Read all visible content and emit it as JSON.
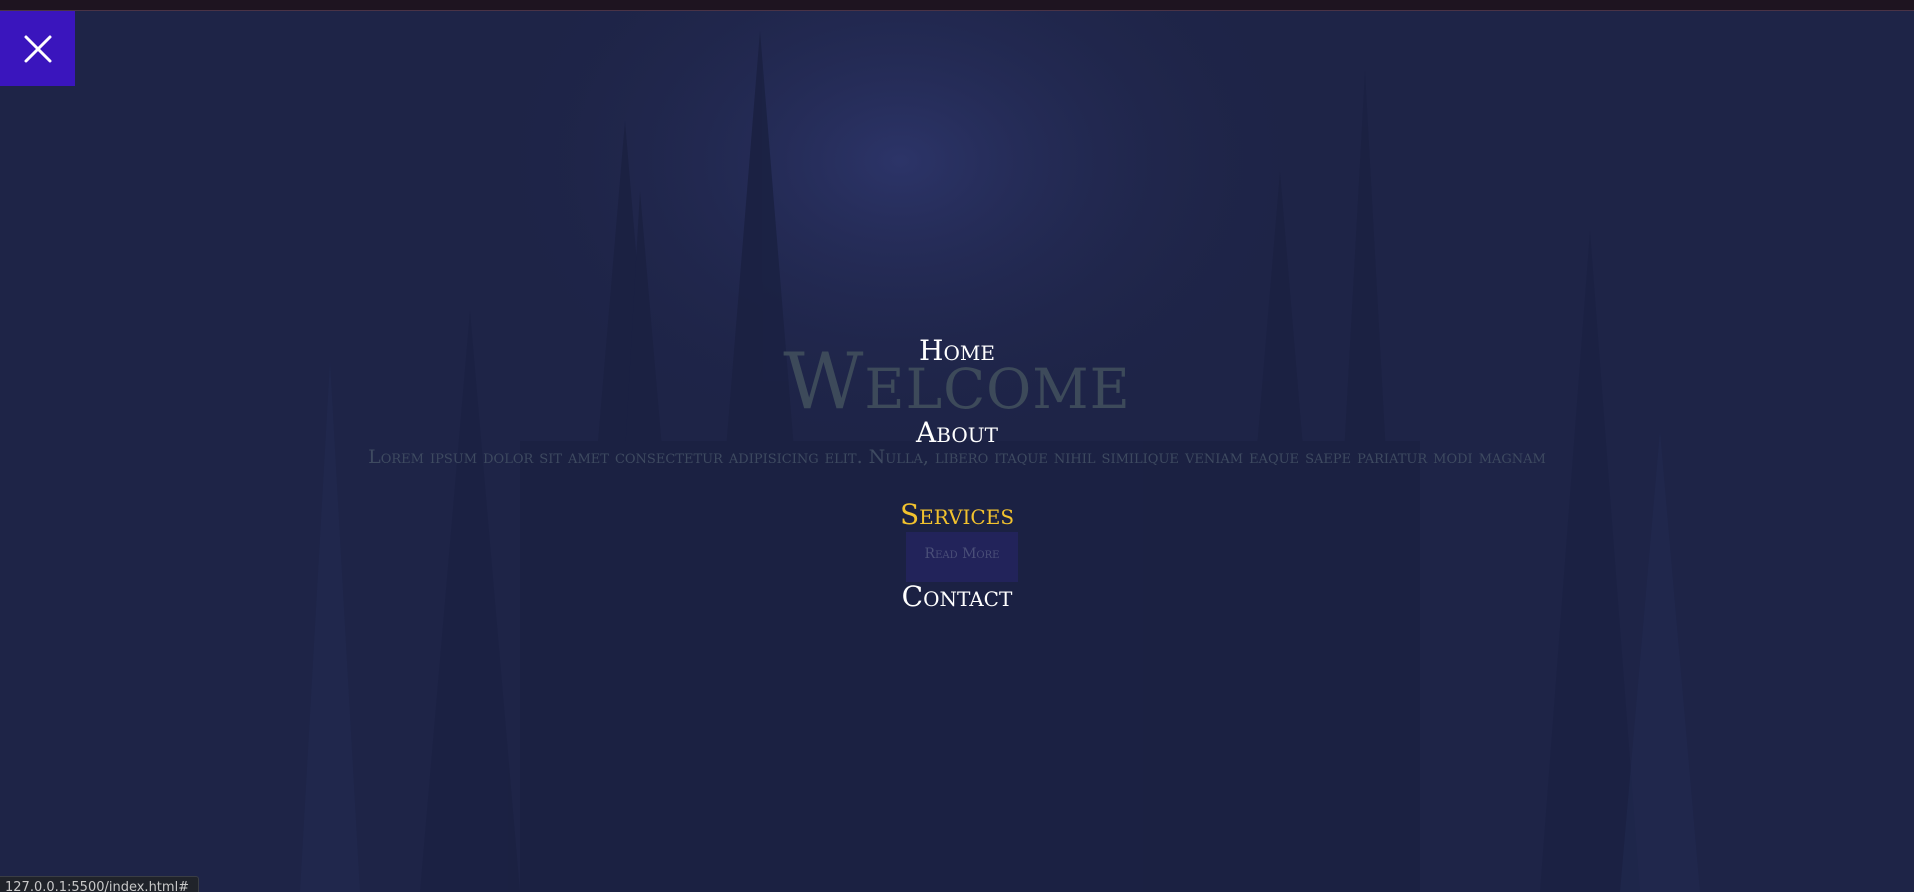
{
  "hero": {
    "title": "Welcome",
    "text": "Lorem ipsum dolor sit amet consectetur adipisicing elit. Nulla, libero itaque nihil similique veniam eaque saepe pariatur modi magnam",
    "button_label": "Read More"
  },
  "nav": {
    "items": [
      {
        "label": "Home",
        "active": false
      },
      {
        "label": "About",
        "active": false
      },
      {
        "label": "Services",
        "active": true
      },
      {
        "label": "Contact",
        "active": false
      }
    ]
  },
  "close_button": {
    "icon": "close-icon"
  },
  "status_bar": {
    "url": "127.0.0.1:5500/index.html#"
  },
  "colors": {
    "background": "#1e2447",
    "close_button": "#3a15bd",
    "active_link": "#f2c22e",
    "link": "#ffffff"
  }
}
